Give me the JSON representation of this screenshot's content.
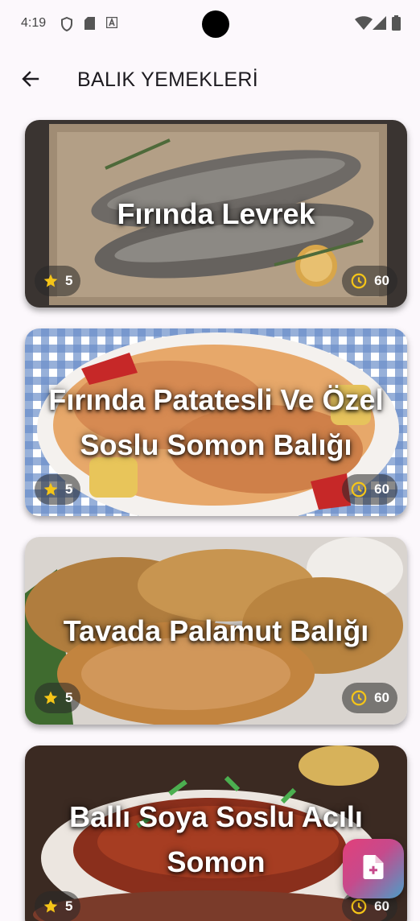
{
  "status_bar": {
    "time": "4:19",
    "left_icons": [
      "shield-icon",
      "sd-card-icon",
      "text-a-icon"
    ],
    "right_icons": [
      "wifi-icon",
      "signal-icon",
      "battery-icon"
    ]
  },
  "app_bar": {
    "back_icon": "arrow-back-icon",
    "title": "BALIK YEMEKLERİ"
  },
  "recipes": [
    {
      "title": "Fırında Levrek",
      "rating": "5",
      "time": "60"
    },
    {
      "title": "Fırında Patatesli Ve Özel Soslu Somon Balığı",
      "rating": "5",
      "time": "60"
    },
    {
      "title": "Tavada Palamut Balığı",
      "rating": "5",
      "time": "60"
    },
    {
      "title": "Ballı Soya Soslu Acılı Somon",
      "rating": "5",
      "time": "60"
    }
  ],
  "icons": {
    "rating": "star-icon",
    "time": "clock-icon",
    "fab": "note-add-icon"
  },
  "colors": {
    "star": "#f5c518",
    "clock": "#f5c518",
    "background": "#fcf8fc"
  }
}
